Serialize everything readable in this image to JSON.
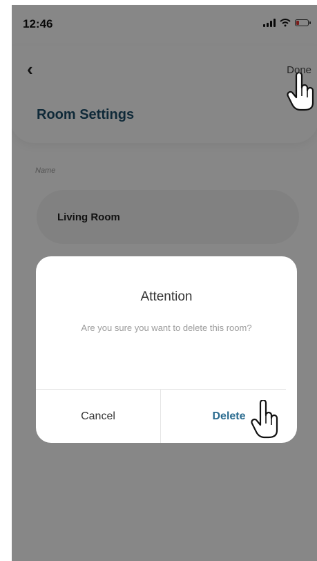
{
  "status_bar": {
    "time": "12:46"
  },
  "header": {
    "back_icon": "chevron-left-icon",
    "done_label": "Done",
    "title": "Room Settings"
  },
  "form": {
    "name_label": "Name",
    "name_value": "Living Room"
  },
  "dialog": {
    "title": "Attention",
    "message": "Are you sure you want to delete this room?",
    "cancel_label": "Cancel",
    "delete_label": "Delete"
  },
  "colors": {
    "accent": "#2a6b8f",
    "title": "#1d4f6b",
    "battery_low": "#e53935"
  }
}
